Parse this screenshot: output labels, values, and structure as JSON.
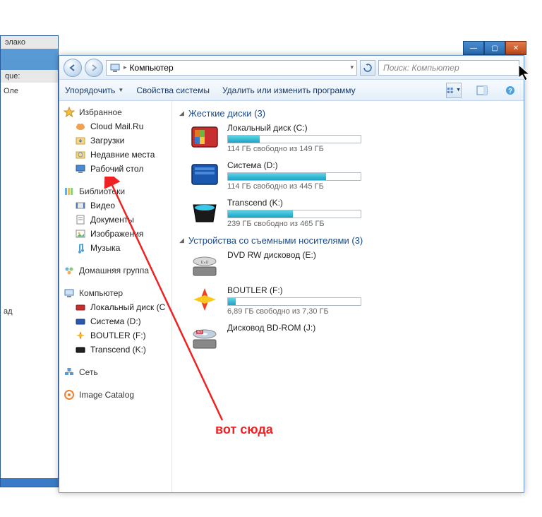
{
  "bg": {
    "strip1": "элако",
    "strip2": "que:",
    "line1": "Оле",
    "line2": "ад"
  },
  "window_controls": {
    "min": "—",
    "max": "▢",
    "close": "✕"
  },
  "nav": {
    "breadcrumb_icon": "computer",
    "breadcrumb": "Компьютер",
    "search_placeholder": "Поиск: Компьютер"
  },
  "toolbar": {
    "organize": "Упорядочить",
    "props": "Свойства системы",
    "uninstall": "Удалить или изменить программу"
  },
  "sidebar": {
    "favorites": {
      "label": "Избранное",
      "items": [
        {
          "icon": "cloud",
          "label": "Cloud Mail.Ru"
        },
        {
          "icon": "downloads",
          "label": "Загрузки"
        },
        {
          "icon": "recent",
          "label": "Недавние места"
        },
        {
          "icon": "desktop",
          "label": "Рабочий стол"
        }
      ]
    },
    "libraries": {
      "label": "Библиотеки",
      "items": [
        {
          "icon": "video",
          "label": "Видео"
        },
        {
          "icon": "docs",
          "label": "Документы"
        },
        {
          "icon": "pics",
          "label": "Изображения"
        },
        {
          "icon": "music",
          "label": "Музыка"
        }
      ]
    },
    "homegroup": {
      "label": "Домашняя группа"
    },
    "computer": {
      "label": "Компьютер",
      "items": [
        {
          "icon": "hdd-red",
          "label": "Локальный диск (C"
        },
        {
          "icon": "hdd-blue",
          "label": "Система (D:)"
        },
        {
          "icon": "hdd-orange",
          "label": "BOUTLER (F:)"
        },
        {
          "icon": "hdd-black",
          "label": "Transcend (K:)"
        }
      ]
    },
    "network": {
      "label": "Сеть"
    },
    "catalog": {
      "label": "Image Catalog"
    }
  },
  "sections": {
    "hdd": {
      "label": "Жесткие диски (3)"
    },
    "removable": {
      "label": "Устройства со съемными носителями (3)"
    }
  },
  "drives": {
    "c": {
      "name": "Локальный диск (C:)",
      "sub": "114 ГБ свободно из 149 ГБ",
      "fill": 24
    },
    "d": {
      "name": "Система (D:)",
      "sub": "114 ГБ свободно из 445 ГБ",
      "fill": 74
    },
    "k": {
      "name": "Transcend (K:)",
      "sub": "239 ГБ свободно из 465 ГБ",
      "fill": 49
    },
    "e": {
      "name": "DVD RW дисковод (E:)"
    },
    "f": {
      "name": "BOUTLER (F:)",
      "sub": "6,89 ГБ свободно из 7,30 ГБ",
      "fill": 6
    },
    "j": {
      "name": "Дисковод BD-ROM (J:)"
    }
  },
  "annotation": "вот сюда"
}
